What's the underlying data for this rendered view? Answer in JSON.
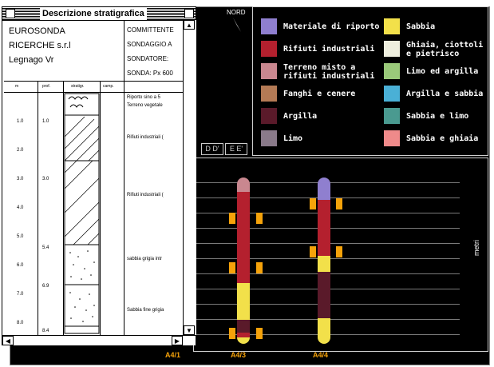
{
  "window": {
    "title": "Descrizione stratigrafica",
    "company": [
      "EUROSONDA",
      "RICERCHE s.r.l",
      "Legnago  Vr"
    ],
    "header_right": [
      "COMMITTENTE",
      "SONDAGGIO A",
      "SONDATORE:",
      "SONDA: Px 600"
    ],
    "col_headers": [
      "m",
      "prof.",
      "stratigr.",
      "camp."
    ],
    "depths_m": [
      "1.0",
      "2.0",
      "3.0",
      "4.0",
      "5.0",
      "6.0",
      "7.0",
      "8.0"
    ],
    "prof": [
      "1.0",
      "3.0",
      "5.4",
      "6.9",
      "8.4"
    ],
    "descriptions": [
      "Riporto sino a 5",
      "Terreno vegetale",
      "Rifiuti industriali (",
      "Rifiuti industriali (",
      "sabbia grigia intr",
      "Sabbia fine grigia"
    ]
  },
  "north_label": "NORD",
  "direction_buttons": [
    "D D'",
    "E E'"
  ],
  "legend": [
    {
      "label": "Materiale di riporto",
      "color": "#8f7fcf"
    },
    {
      "label": "Rifiuti industriali",
      "color": "#b4202e"
    },
    {
      "label": "Terreno misto a rifiuti industriali",
      "color": "#c9878f"
    },
    {
      "label": "Fanghi e cenere",
      "color": "#b47a55"
    },
    {
      "label": "Argilla",
      "color": "#5a1a2a"
    },
    {
      "label": "Limo",
      "color": "#8a7a8a"
    },
    {
      "label": "Sabbia",
      "color": "#f2e04a"
    },
    {
      "label": "Ghiaia, ciottoli e pietrisco",
      "color": "#eeeede"
    },
    {
      "label": "Limo ed argilla",
      "color": "#9ac97a"
    },
    {
      "label": "Argilla e sabbia",
      "color": "#4ab0d6"
    },
    {
      "label": "Sabbia e limo",
      "color": "#4a9a90"
    },
    {
      "label": "Sabbia e ghiaia",
      "color": "#ef8a8a"
    }
  ],
  "axis_label": "metri",
  "columns": [
    {
      "name": "A4/1"
    },
    {
      "name": "A4/3",
      "layers": [
        "Terreno misto a rifiuti industriali",
        "Rifiuti industriali",
        "Sabbia",
        "Argilla",
        "Rifiuti industriali",
        "Sabbia"
      ]
    },
    {
      "name": "A4/4",
      "layers": [
        "Materiale di riporto",
        "Rifiuti industriali",
        "Sabbia",
        "Argilla",
        "Sabbia"
      ]
    }
  ]
}
